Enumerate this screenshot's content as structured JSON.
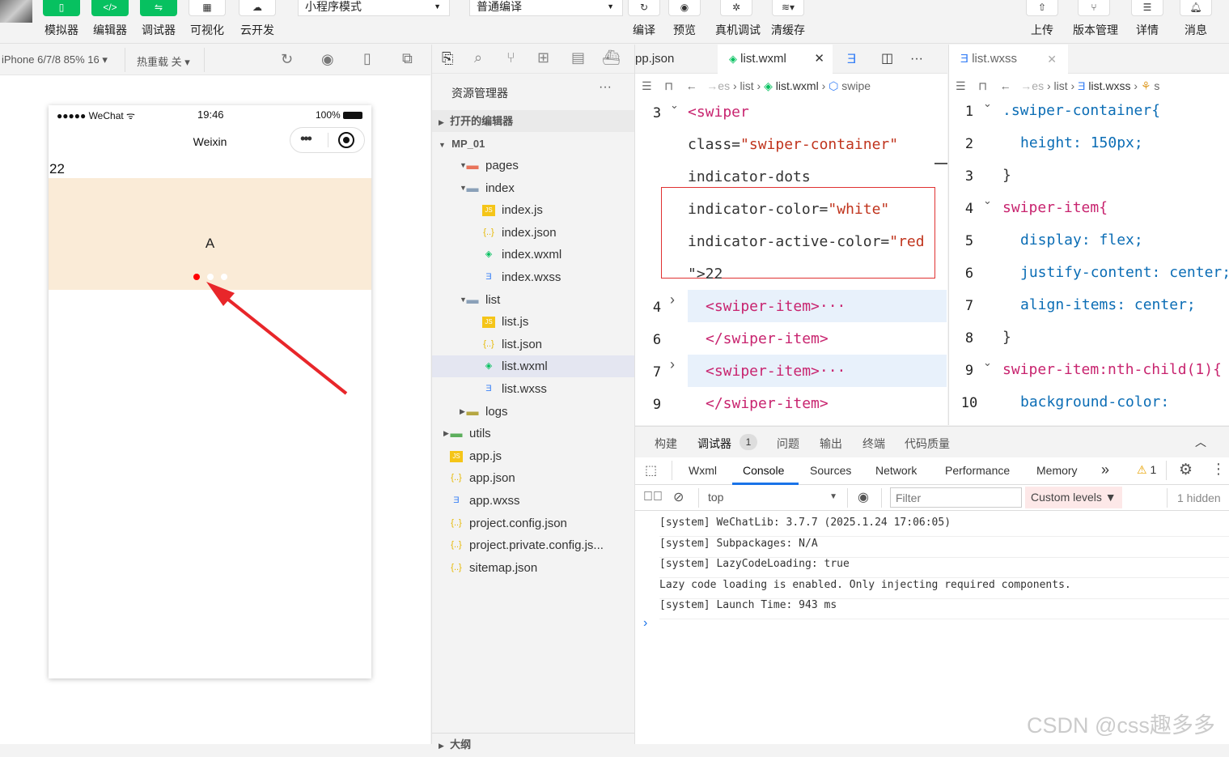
{
  "toolbar": {
    "buttons": [
      {
        "label": "模拟器",
        "icon": "phone-icon"
      },
      {
        "label": "编辑器",
        "icon": "code-icon"
      },
      {
        "label": "调试器",
        "icon": "sliders-icon"
      },
      {
        "label": "可视化",
        "icon": "layout-icon"
      },
      {
        "label": "云开发",
        "icon": "cloud-icon"
      }
    ],
    "mode_select": "小程序模式",
    "compile_select": "普通编译",
    "actions": [
      "编译",
      "预览",
      "真机调试",
      "清缓存"
    ],
    "right_actions": [
      "上传",
      "版本管理",
      "详情",
      "消息"
    ]
  },
  "simulator": {
    "device": "iPhone 6/7/8 85% 16",
    "hot_reload": "热重载 关",
    "status_carrier": "●●●●● WeChat",
    "status_time": "19:46",
    "status_battery": "100%",
    "nav_title": "Weixin",
    "page_text": "22",
    "swiper_item_text": "A",
    "active_dot_color": "#ff0000",
    "swiper_bg": "#faebd7"
  },
  "explorer": {
    "title": "资源管理器",
    "open_editors": "打开的编辑器",
    "project": "MP_01",
    "items": [
      {
        "label": "pages",
        "type": "folder-open"
      },
      {
        "label": "index",
        "type": "folder-open"
      },
      {
        "label": "index.js",
        "type": "js"
      },
      {
        "label": "index.json",
        "type": "json"
      },
      {
        "label": "index.wxml",
        "type": "wxml"
      },
      {
        "label": "index.wxss",
        "type": "wxss"
      },
      {
        "label": "list",
        "type": "folder-open"
      },
      {
        "label": "list.js",
        "type": "js"
      },
      {
        "label": "list.json",
        "type": "json"
      },
      {
        "label": "list.wxml",
        "type": "wxml"
      },
      {
        "label": "list.wxss",
        "type": "wxss"
      },
      {
        "label": "logs",
        "type": "folder"
      },
      {
        "label": "utils",
        "type": "folder"
      },
      {
        "label": "app.js",
        "type": "js"
      },
      {
        "label": "app.json",
        "type": "json"
      },
      {
        "label": "app.wxss",
        "type": "wxss"
      },
      {
        "label": "project.config.json",
        "type": "json"
      },
      {
        "label": "project.private.config.js...",
        "type": "json"
      },
      {
        "label": "sitemap.json",
        "type": "json"
      }
    ],
    "outline": "大纲"
  },
  "editor1": {
    "tab_prev": "pp.json",
    "tab_active": "list.wxml",
    "crumbs": [
      "es",
      "list",
      "list.wxml",
      "swipe"
    ],
    "lines": [
      {
        "n": "3",
        "t": "<swiper"
      },
      {
        "n": "",
        "t": "class=\"swiper-container\""
      },
      {
        "n": "",
        "t": "indicator-dots"
      },
      {
        "n": "",
        "t": "indicator-color=\"white\""
      },
      {
        "n": "",
        "t": "indicator-active-color=\"red"
      },
      {
        "n": "",
        "t": "\">22"
      },
      {
        "n": "4",
        "t": "<swiper-item>···"
      },
      {
        "n": "6",
        "t": "</swiper-item>"
      },
      {
        "n": "7",
        "t": "<swiper-item>···"
      },
      {
        "n": "9",
        "t": "</swiper-item>"
      }
    ]
  },
  "editor2": {
    "tab": "list.wxss",
    "crumbs": [
      "es",
      "list",
      "list.wxss",
      "s"
    ],
    "lines": [
      {
        "n": "1",
        "t": ".swiper-container{"
      },
      {
        "n": "2",
        "t": "height: 150px;"
      },
      {
        "n": "3",
        "t": "}"
      },
      {
        "n": "4",
        "t": "swiper-item{"
      },
      {
        "n": "5",
        "t": "display: flex;"
      },
      {
        "n": "6",
        "t": "justify-content: center;"
      },
      {
        "n": "7",
        "t": "align-items: center;"
      },
      {
        "n": "8",
        "t": "}"
      },
      {
        "n": "9",
        "t": "swiper-item:nth-child(1){"
      },
      {
        "n": "10",
        "t": "background-color:"
      }
    ]
  },
  "devtools": {
    "panel_tabs": [
      "构建",
      "调试器",
      "问题",
      "输出",
      "终端",
      "代码质量"
    ],
    "badge": "1",
    "tabs": [
      "Wxml",
      "Console",
      "Sources",
      "Network",
      "Performance",
      "Memory"
    ],
    "more": "»",
    "warn_count": "1",
    "context": "top",
    "filter_placeholder": "Filter",
    "levels": "Custom levels ▼",
    "hidden": "1 hidden",
    "console": [
      "[system] WeChatLib: 3.7.7 (2025.1.24 17:06:05)",
      "[system] Subpackages: N/A",
      "[system] LazyCodeLoading: true",
      "Lazy code loading is enabled. Only injecting required components.",
      "[system] Launch Time: 943 ms"
    ],
    "prompt": "›"
  },
  "watermark": "CSDN @css趣多多"
}
